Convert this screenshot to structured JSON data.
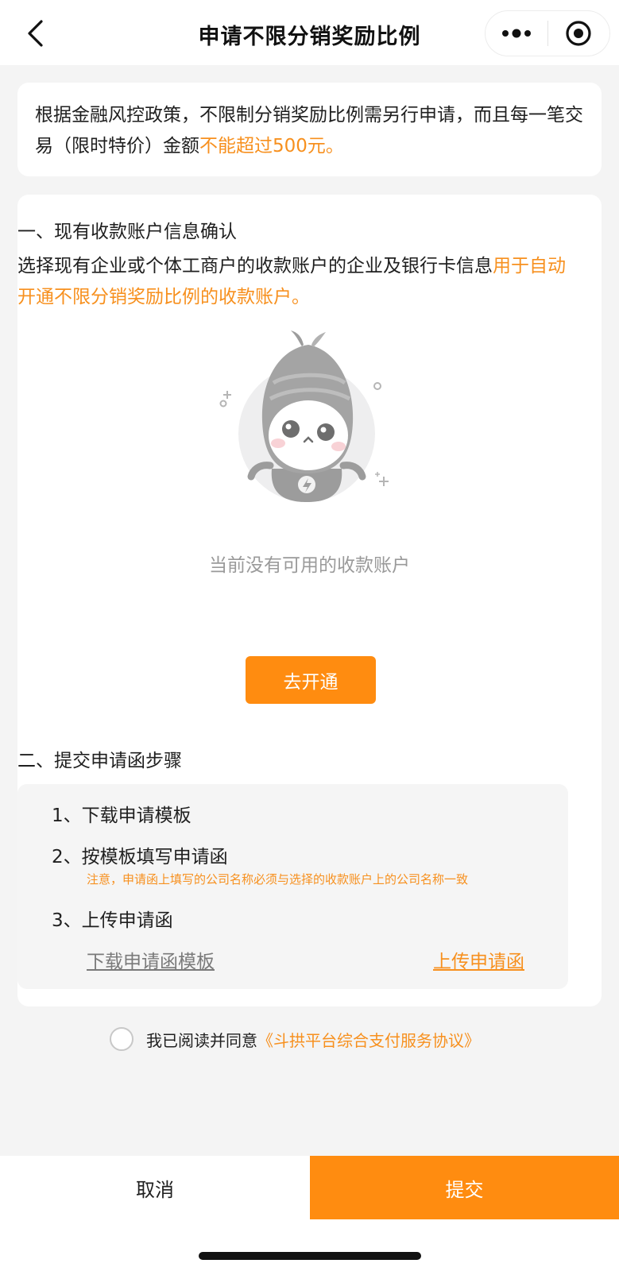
{
  "navbar": {
    "title": "申请不限分销奖励比例",
    "icons": [
      "back-icon",
      "more-icon",
      "close-mini-program-icon"
    ]
  },
  "notice": {
    "text_normal": "根据金融风控政策，不限制分销奖励比例需另行申请，而且每一笔交易（限时特价）金额",
    "text_highlight": "不能超过500元。"
  },
  "section1": {
    "title": "一、现有收款账户信息确认",
    "desc_normal": "选择现有企业或个体工商户的收款账户的企业及银行卡信息",
    "desc_highlight": "用于自动开通不限分销奖励比例的收款账户。",
    "empty_text": "当前没有可用的收款账户",
    "open_button": "去开通"
  },
  "section2": {
    "title": "二、提交申请函步骤",
    "steps": [
      "1、下载申请模板",
      "2、按模板填写申请函",
      "3、上传申请函"
    ],
    "note": "注意，申请函上填写的公司名称必须与选择的收款账户上的公司名称一致",
    "download_link": "下载申请函模板",
    "upload_link": "上传申请函"
  },
  "agreement": {
    "text": "我已阅读并同意",
    "link": "《斗拱平台综合支付服务协议》",
    "checked": false
  },
  "actions": {
    "cancel": "取消",
    "submit": "提交"
  },
  "colors": {
    "accent": "#ff8c10",
    "highlight_text": "#f7901e",
    "background": "#f4f4f4"
  }
}
